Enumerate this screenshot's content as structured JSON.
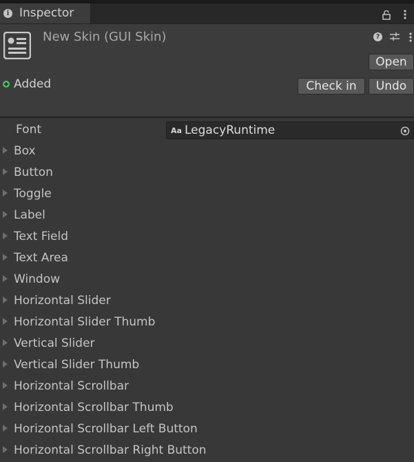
{
  "tab": {
    "title": "Inspector",
    "icon": "info-icon"
  },
  "header": {
    "title": "New Skin (GUI Skin)",
    "status": "Added",
    "status_color": "#4ec25a",
    "buttons": {
      "open": "Open",
      "check_in": "Check in",
      "undo": "Undo"
    }
  },
  "font_field": {
    "label": "Font",
    "value": "LegacyRuntime",
    "icon_text": "Aa"
  },
  "properties": [
    "Box",
    "Button",
    "Toggle",
    "Label",
    "Text Field",
    "Text Area",
    "Window",
    "Horizontal Slider",
    "Horizontal Slider Thumb",
    "Vertical Slider",
    "Vertical Slider Thumb",
    "Horizontal Scrollbar",
    "Horizontal Scrollbar Thumb",
    "Horizontal Scrollbar Left Button",
    "Horizontal Scrollbar Right Button"
  ]
}
